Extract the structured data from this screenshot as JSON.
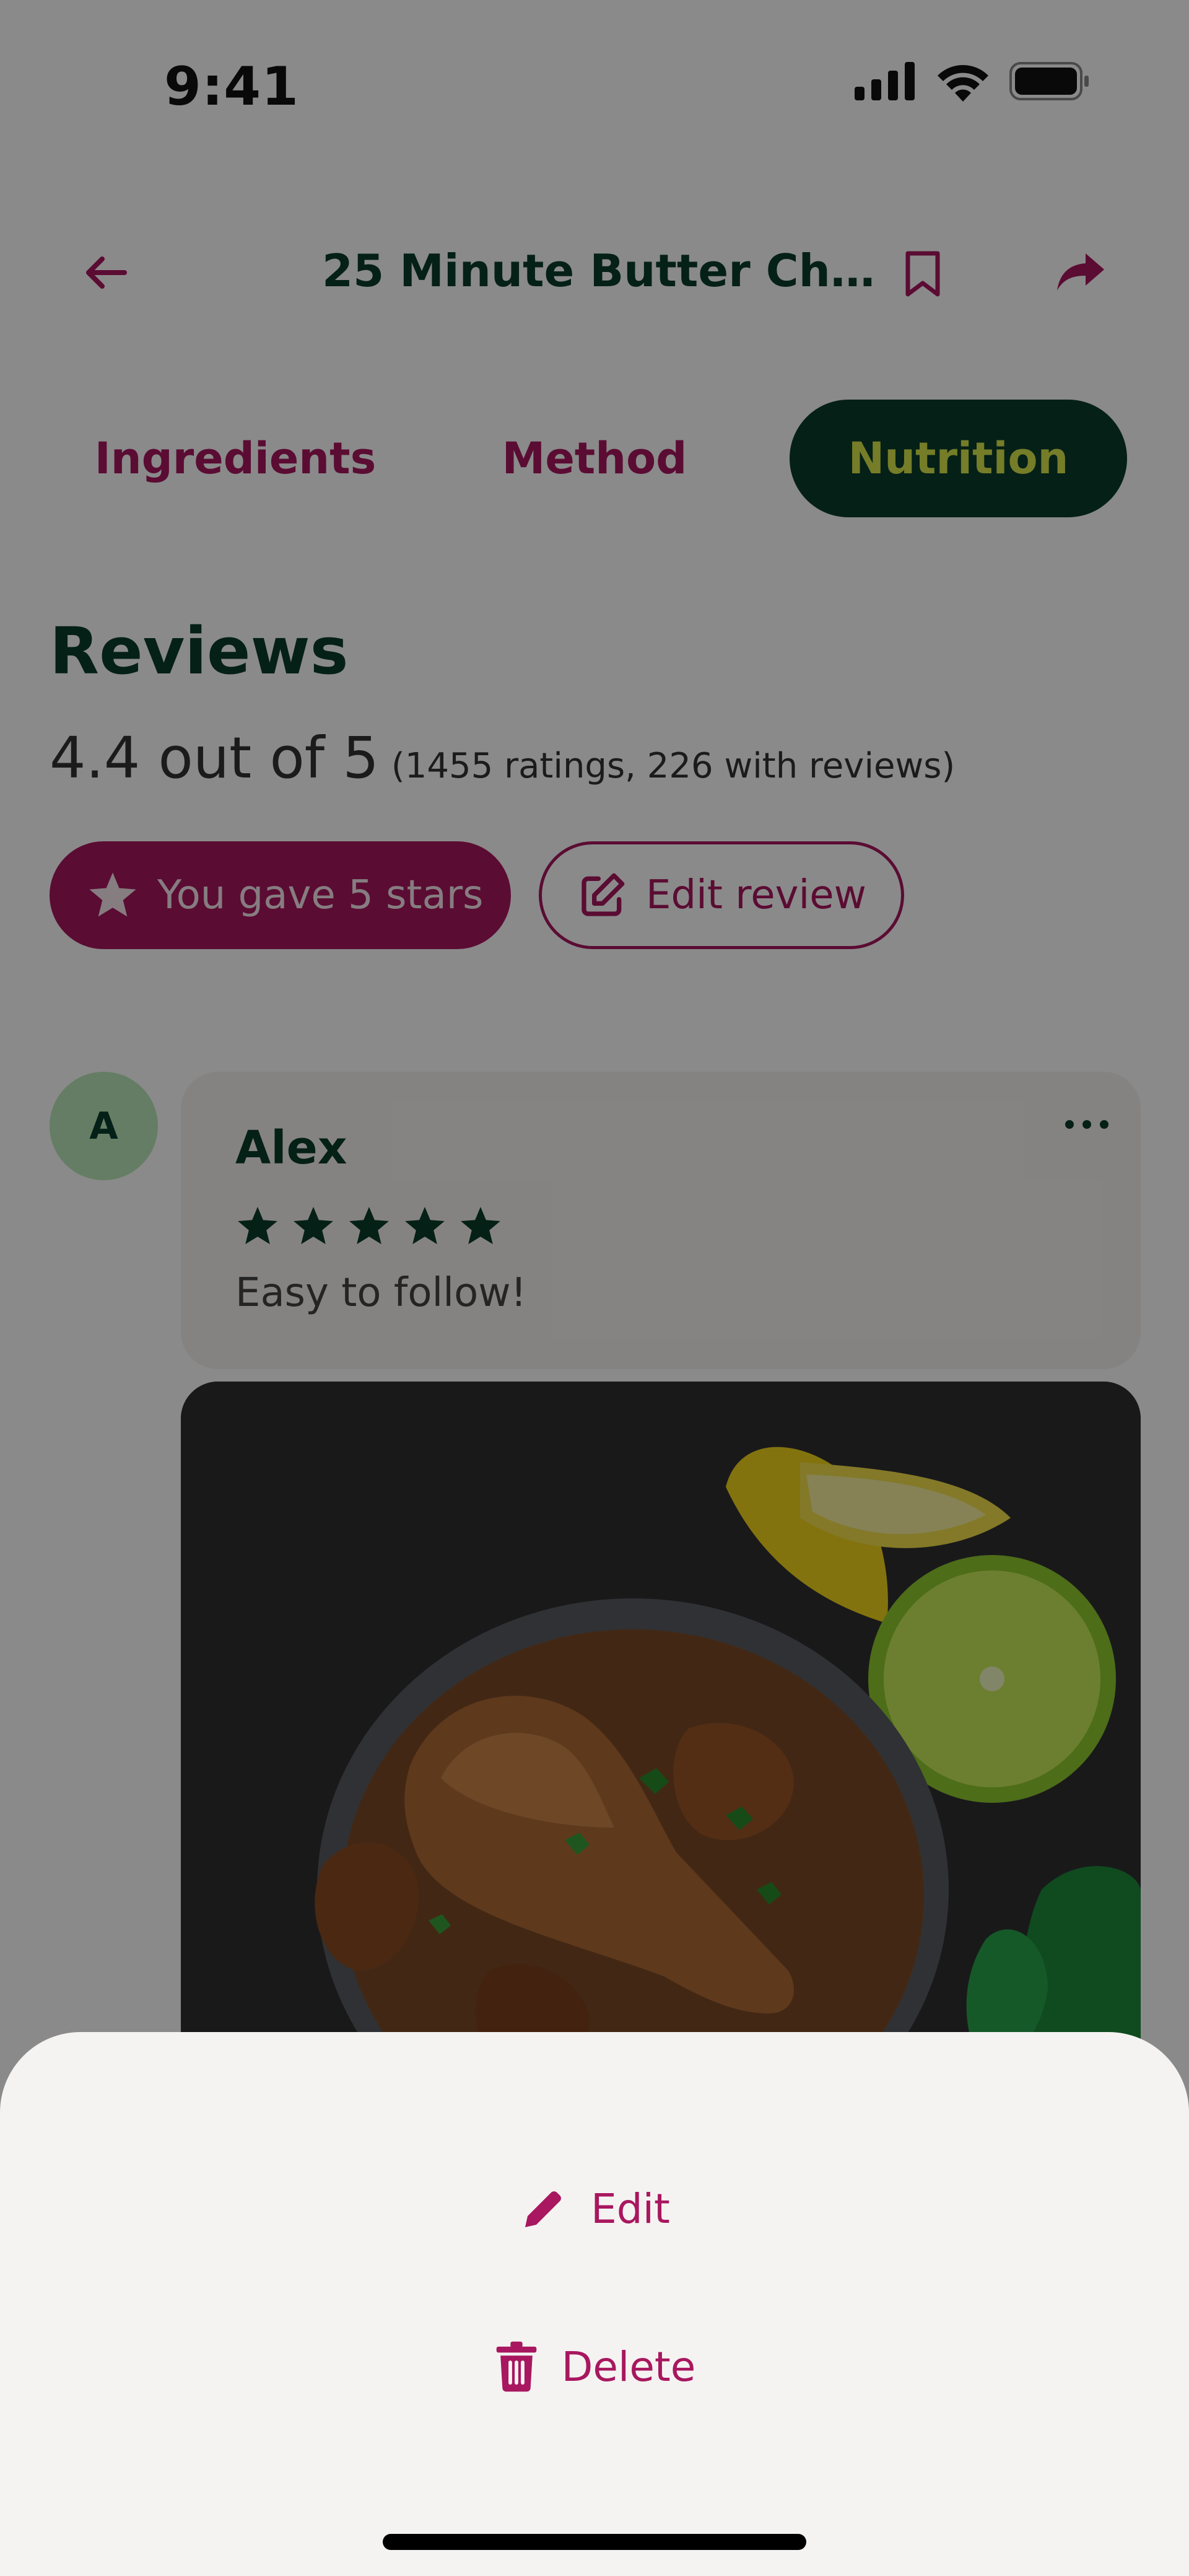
{
  "status_bar": {
    "time": "9:41"
  },
  "header": {
    "title": "25 Minute Butter Ch..."
  },
  "tabs": [
    {
      "label": "Ingredients",
      "active": false
    },
    {
      "label": "Method",
      "active": false
    },
    {
      "label": "Nutrition",
      "active": true
    }
  ],
  "reviews": {
    "heading": "Reviews",
    "rating_text": "4.4 out of 5",
    "rating_meta": "(1455 ratings, 226 with reviews)",
    "gave_stars_label": "You gave 5 stars",
    "edit_review_label": "Edit review"
  },
  "review": {
    "avatar_initial": "A",
    "name": "Alex",
    "stars": 5,
    "text": "Easy to follow!"
  },
  "sheet": {
    "edit_label": "Edit",
    "delete_label": "Delete"
  },
  "colors": {
    "brand_magenta": "#a8175f",
    "dark_green": "#0b3b2b",
    "lime": "#d8e84a",
    "sheet_bg": "#f5f3f1",
    "avatar_green": "#b9e8b9"
  },
  "icons": [
    "signal-icon",
    "wifi-icon",
    "battery-icon",
    "back-arrow-icon",
    "bookmark-icon",
    "share-icon",
    "star-icon",
    "edit-review-icon",
    "more-icon",
    "pencil-icon",
    "trash-icon"
  ]
}
